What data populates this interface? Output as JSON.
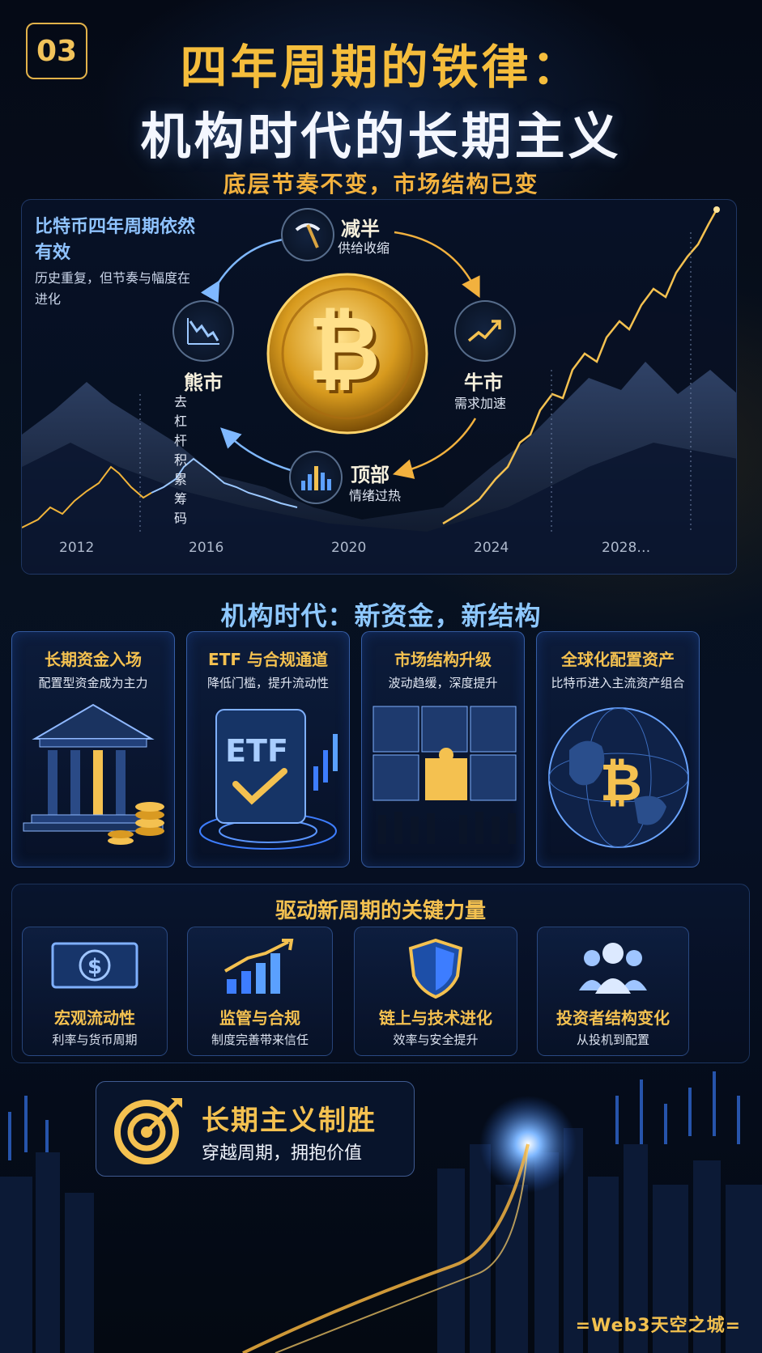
{
  "header": {
    "number": "03",
    "title_line1": "四年周期的铁律：",
    "title_line2": "机构时代的长期主义",
    "subtitle": "底层节奏不变，市场结构已变"
  },
  "hero": {
    "heading": "比特币四年周期依然有效",
    "note": "历史重复，但节奏与幅度在进化",
    "stages": [
      {
        "name": "减半",
        "desc": "供给收缩",
        "icon": "pickaxe-icon"
      },
      {
        "name": "牛市",
        "desc": "需求加速",
        "icon": "uptrend-icon"
      },
      {
        "name": "顶部",
        "desc": "情绪过热",
        "icon": "bar-peak-icon"
      },
      {
        "name": "熊市",
        "desc": "去杠杆\n积累筹码",
        "icon": "downtrend-icon"
      }
    ],
    "years": [
      "2012",
      "2016",
      "2020",
      "2024",
      "2028…"
    ]
  },
  "institutional": {
    "title": "机构时代：新资金，新结构",
    "cards": [
      {
        "title": "长期资金入场",
        "desc": "配置型资金成为主力",
        "icon": "bank-icon"
      },
      {
        "title": "ETF 与合规通道",
        "desc": "降低门槛，提升流动性",
        "icon": "etf-check-icon",
        "badge": "ETF"
      },
      {
        "title": "市场结构升级",
        "desc": "波动趋缓，深度提升",
        "icon": "puzzle-icon"
      },
      {
        "title": "全球化配置资产",
        "desc": "比特币进入主流资产组合",
        "icon": "globe-bitcoin-icon"
      }
    ]
  },
  "forces": {
    "title": "驱动新周期的关键力量",
    "items": [
      {
        "title": "宏观流动性",
        "desc": "利率与货币周期",
        "icon": "dollar-bill-icon"
      },
      {
        "title": "监管与合规",
        "desc": "制度完善带来信任",
        "icon": "growth-chart-icon"
      },
      {
        "title": "链上与技术进化",
        "desc": "效率与安全提升",
        "icon": "shield-icon"
      },
      {
        "title": "投资者结构变化",
        "desc": "从投机到配置",
        "icon": "people-icon"
      }
    ]
  },
  "footer": {
    "motto_title": "长期主义制胜",
    "motto_desc": "穿越周期，拥抱价值",
    "brand": "=Web3天空之城="
  },
  "colors": {
    "gold": "#f4c150",
    "blue": "#8ec8ff",
    "background": "#05091a"
  }
}
